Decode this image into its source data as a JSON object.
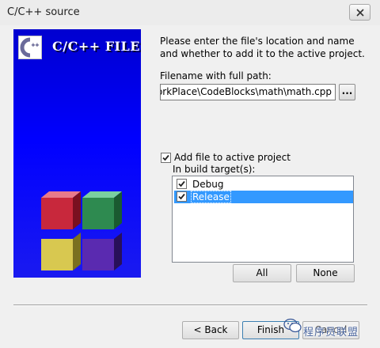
{
  "window": {
    "title": "C/C++ source"
  },
  "banner": {
    "title": "C/C++ FILE",
    "logo_text": "C++"
  },
  "form": {
    "intro": "Please enter the file's location and name and whether to add it to the active project.",
    "path_label": "Filename with full path:",
    "path_value": "F:\\WorkPlace\\CodeBlocks\\math\\math.cpp",
    "browse_label": "...",
    "add_to_project_label": "Add file to active project",
    "add_to_project_checked": true,
    "build_targets_label": "In build target(s):",
    "targets": [
      {
        "label": "Debug",
        "checked": true,
        "selected": false
      },
      {
        "label": "Release",
        "checked": true,
        "selected": true
      }
    ],
    "all_label": "All",
    "none_label": "None"
  },
  "footer": {
    "back_label": "< Back",
    "finish_label": "Finish",
    "cancel_label": "Cancel"
  },
  "watermark": {
    "text": "程序员联盟"
  },
  "colors": {
    "banner": "#0000ff",
    "selection": "#3399ff",
    "watermark": "#3b5998"
  }
}
